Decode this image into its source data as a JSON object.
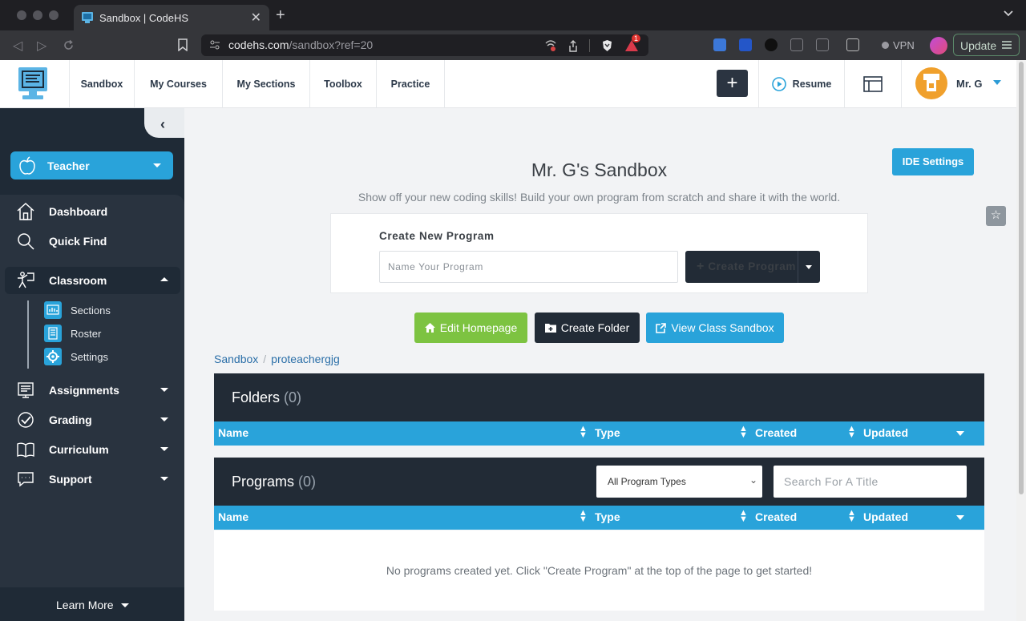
{
  "browser": {
    "tab_title": "Sandbox | CodeHS",
    "url_host": "codehs.com",
    "url_path": "/sandbox?ref=20",
    "vpn_label": "VPN",
    "update_label": "Update",
    "notification_count": "1"
  },
  "header": {
    "nav": [
      "Sandbox",
      "My Courses",
      "My Sections",
      "Toolbox",
      "Practice"
    ],
    "resume_label": "Resume",
    "user_name": "Mr. G",
    "plus_icon": "plus-icon"
  },
  "sidebar": {
    "role_label": "Teacher",
    "items": [
      {
        "label": "Dashboard",
        "icon": "home-icon"
      },
      {
        "label": "Quick Find",
        "icon": "search-icon"
      },
      {
        "label": "Classroom",
        "icon": "classroom-icon"
      },
      {
        "label": "Assignments",
        "icon": "assignments-icon"
      },
      {
        "label": "Grading",
        "icon": "grading-icon"
      },
      {
        "label": "Curriculum",
        "icon": "book-icon"
      },
      {
        "label": "Support",
        "icon": "support-icon"
      }
    ],
    "sub_items": [
      {
        "label": "Sections",
        "icon": "sections-icon"
      },
      {
        "label": "Roster",
        "icon": "roster-icon"
      },
      {
        "label": "Settings",
        "icon": "settings-icon"
      }
    ],
    "learn_more": "Learn More"
  },
  "main": {
    "ide_settings": "IDE Settings",
    "title": "Mr. G's Sandbox",
    "subtitle": "Show off your new coding skills! Build your own program from scratch and share it with the world.",
    "create_label": "Create New Program",
    "name_placeholder": "Name Your Program",
    "create_button": "Create Program",
    "edit_homepage": "Edit Homepage",
    "create_folder": "Create Folder",
    "view_class_sandbox": "View Class Sandbox",
    "breadcrumb": [
      "Sandbox",
      "proteachergjg"
    ],
    "folders_title": "Folders",
    "folders_count": "(0)",
    "programs_title": "Programs",
    "programs_count": "(0)",
    "columns": [
      "Name",
      "Type",
      "Created",
      "Updated"
    ],
    "program_type_selected": "All Program Types",
    "search_placeholder": "Search For A Title",
    "empty_message": "No programs created yet. Click \"Create Program\" at the top of the page to get started!"
  },
  "colors": {
    "accent_blue": "#29a3da",
    "dark_navy": "#222b36",
    "green": "#7dc341"
  }
}
